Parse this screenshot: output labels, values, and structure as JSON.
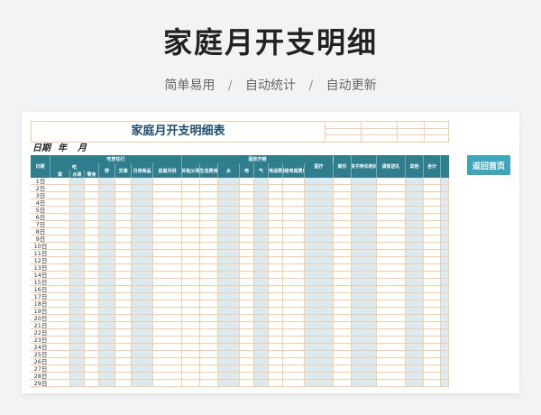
{
  "banner": {
    "title": "家庭月开支明细",
    "subtitle": [
      "简单易用",
      "自动统计",
      "自动更新"
    ],
    "separator": "/"
  },
  "sheet": {
    "title": "家庭月开支明细表",
    "date_label": "日期",
    "year_label": "年",
    "month_label": "月",
    "header_groups": {
      "group1": "吃穿住行",
      "group2": "固定开销"
    },
    "columns": [
      {
        "key": "date",
        "label": "日期"
      },
      {
        "key": "food",
        "label": "吃"
      },
      {
        "key": "veg",
        "label": "菜"
      },
      {
        "key": "fruit",
        "label": "水果"
      },
      {
        "key": "snack",
        "label": "零食"
      },
      {
        "key": "clothes",
        "label": "穿"
      },
      {
        "key": "transport",
        "label": "交通"
      },
      {
        "key": "daily",
        "label": "日用商品"
      },
      {
        "key": "rent",
        "label": "房屋月供"
      },
      {
        "key": "parents",
        "label": "补贴父母"
      },
      {
        "key": "living",
        "label": "生活费用"
      },
      {
        "key": "water",
        "label": "水"
      },
      {
        "key": "power",
        "label": "电"
      },
      {
        "key": "gas",
        "label": "气"
      },
      {
        "key": "phone",
        "label": "电话费"
      },
      {
        "key": "tv",
        "label": "网络电视费用"
      },
      {
        "key": "medical",
        "label": "医疗"
      },
      {
        "key": "fun",
        "label": "娱乐"
      },
      {
        "key": "kids",
        "label": "孩子特长培训"
      },
      {
        "key": "social",
        "label": "请客送礼"
      },
      {
        "key": "other",
        "label": "其他"
      },
      {
        "key": "total",
        "label": "合计"
      }
    ],
    "days": [
      "1日",
      "2日",
      "3日",
      "4日",
      "5日",
      "6日",
      "7日",
      "8日",
      "9日",
      "10日",
      "11日",
      "12日",
      "13日",
      "14日",
      "15日",
      "16日",
      "17日",
      "18日",
      "19日",
      "20日",
      "21日",
      "22日",
      "23日",
      "24日",
      "25日",
      "26日",
      "27日",
      "28日",
      "29日"
    ]
  },
  "home_button": {
    "label": "返回首页"
  },
  "colors": {
    "header_bg": "#2f7e8e",
    "grid_line": "#f3cfa3",
    "shade": "#dbe9f0",
    "button_bg": "#3ea6bb",
    "title_text": "#1e4f73"
  }
}
